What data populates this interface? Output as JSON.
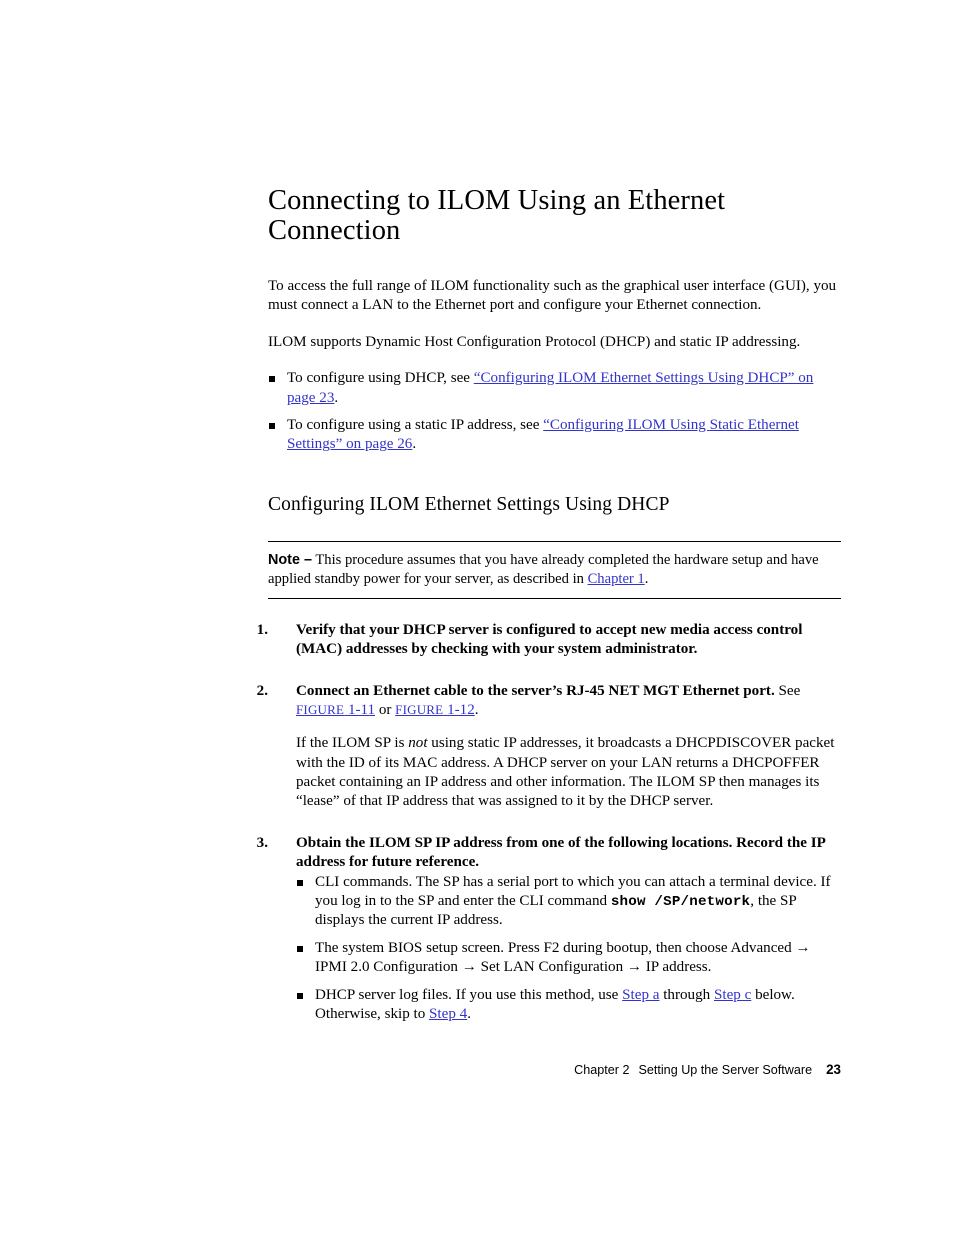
{
  "page": {
    "title": "Connecting to ILOM Using an Ethernet Connection",
    "title_line1": "Connecting to ILOM Using an Ethernet",
    "title_line2": "Connection"
  },
  "link_color": "#3333cc",
  "intro": {
    "paragraph1": "To access the full range of ILOM functionality such as the graphical user interface (GUI), you must connect a LAN to the Ethernet port and configure your Ethernet connection.",
    "paragraph2": "ILOM supports Dynamic Host Configuration Protocol (DHCP) and static IP addressing.",
    "bullets": [
      {
        "pre": "To configure using DHCP, see ",
        "link": "“Configuring ILOM Ethernet Settings Using DHCP” on page 23",
        "post": "."
      },
      {
        "pre": "To configure using a static IP address, see ",
        "link": "“Configuring ILOM Using Static Ethernet Settings” on page 26",
        "post": "."
      }
    ]
  },
  "section": {
    "heading": "Configuring ILOM Ethernet Settings Using DHCP",
    "note": {
      "label": "Note –",
      "text_before_link": " This procedure assumes that you have already completed the hardware setup and have applied standby power for your server, as described in ",
      "link": "Chapter 1",
      "text_after_link": "."
    },
    "steps": [
      {
        "number": "1.",
        "bold_text": "Verify that your DHCP server is configured to accept new media access control (MAC) addresses by checking with your system administrator."
      },
      {
        "number": "2.",
        "bold_text": "Connect an Ethernet cable to the server’s RJ-45 NET MGT Ethernet port.",
        "regular_tail": " See ",
        "fig_link_1_label": "FIGURE",
        "fig_link_1_num": "1-11",
        "fig_conjunction": " or ",
        "fig_link_2_label": "FIGURE",
        "fig_link_2_num": "1-12",
        "fig_tail": ".",
        "body_part1": "If the ILOM SP is ",
        "body_italic": "not",
        "body_part2": " using static IP addresses, it broadcasts a DHCPDISCOVER packet with the ID of its MAC address. A DHCP server on your LAN returns a DHCPOFFER packet containing an IP address and other information. The ILOM SP then manages its “lease” of that IP address that was assigned to it by the DHCP server."
      },
      {
        "number": "3.",
        "bold_text": "Obtain the ILOM SP IP address from one of the following locations. Record the IP address for future reference.",
        "sub_bullets": [
          {
            "part1": "CLI commands. The SP has a serial port to which you can attach a terminal device. If you log in to the SP and enter the CLI command ",
            "command": "show /SP/network",
            "part2": ", the SP displays the current IP address."
          },
          {
            "part1": "The system BIOS setup screen. Press F2 during bootup, then choose Advanced → IPMI 2.0 Configuration → Set LAN Configuration → IP address.",
            "command": "",
            "part2": ""
          },
          {
            "part1": "DHCP server log files. If you use this method, use ",
            "link_a": "Step a",
            "mid": " through ",
            "link_c": "Step c",
            "mid2": " below. Otherwise, skip to ",
            "link_4": "Step 4",
            "part2": "."
          }
        ]
      }
    ]
  },
  "footer": {
    "chapter": "Chapter 2",
    "section_name": "Setting Up the Server Software",
    "page_number": "23"
  }
}
